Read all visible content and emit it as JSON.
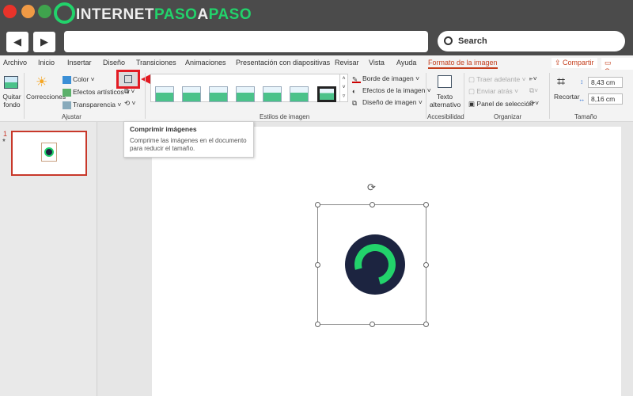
{
  "browser": {
    "brand_part1": "INTERNET",
    "brand_part2": "PASO",
    "brand_part3": "A",
    "brand_part4": "PASO",
    "back_icon": "◀",
    "forward_icon": "▶",
    "search_placeholder": "Search",
    "url": ""
  },
  "tabs": [
    "Archivo",
    "Inicio",
    "Insertar",
    "Diseño",
    "Transiciones",
    "Animaciones",
    "Presentación con diapositivas",
    "Revisar",
    "Vista",
    "Ayuda",
    "Formato de la imagen"
  ],
  "share_label": "Compartir",
  "comments_label": "Comen",
  "ribbon": {
    "ajustar": {
      "quitar_fondo": "Quitar fondo",
      "correcciones": "Correcciones",
      "color": "Color",
      "efectos": "Efectos artísticos",
      "transparencia": "Transparencia",
      "group": "Ajustar"
    },
    "estilos": {
      "borde": "Borde de imagen",
      "efectos": "Efectos de la imagen",
      "diseno": "Diseño de imagen",
      "group": "Estilos de imagen"
    },
    "accesibilidad": {
      "texto_alt": "Texto alternativo",
      "group": "Accesibilidad"
    },
    "organizar": {
      "traer": "Traer adelante",
      "enviar": "Enviar atrás",
      "panel": "Panel de selección",
      "group": "Organizar"
    },
    "tamano": {
      "recortar": "Recortar",
      "height": "8,43 cm",
      "width": "8,16 cm",
      "group": "Tamaño"
    }
  },
  "tooltip": {
    "title": "Comprimir imágenes",
    "body": "Comprime las imágenes en el documento para reducir el tamaño."
  },
  "slides": [
    {
      "number": "1",
      "star": "*"
    }
  ],
  "colors": {
    "accent": "#c43e1c",
    "brand_green": "#22d36b",
    "highlight": "#e31b23"
  }
}
